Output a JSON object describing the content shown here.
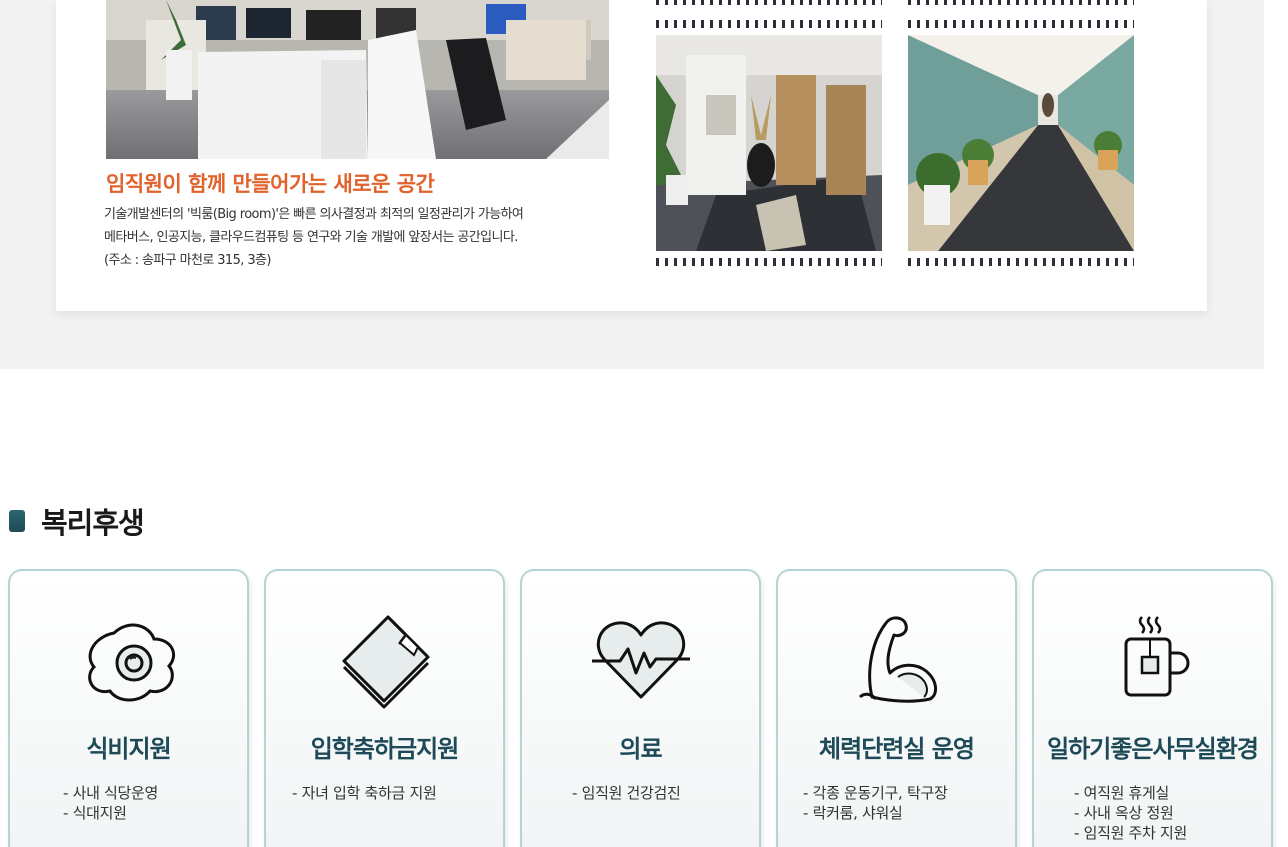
{
  "space": {
    "title": "임직원이 함께 만들어가는 새로운 공간",
    "desc_lines": [
      "기술개발센터의 '빅룸(Big room)'은 빠른 의사결정과 최적의 일정관리가 가능하여",
      "메타버스, 인공지능, 클라우드컴퓨팅 등 연구와 기술 개발에 앞장서는 공간입니다.",
      "(주소 : 송파구 마천로  315, 3층)"
    ]
  },
  "benefits_section": {
    "heading": "복리후생",
    "accent_color": "#1d4a55",
    "title_color": "#1e4a58",
    "cards": [
      {
        "icon": "fried-egg-icon",
        "title": "식비지원",
        "items": [
          "- 사내 식당운영",
          "- 식대지원"
        ]
      },
      {
        "icon": "book-icon",
        "title": "입학축하금지원",
        "items": [
          "- 자녀 입학 축하금 지원"
        ]
      },
      {
        "icon": "heartbeat-icon",
        "title": "의료",
        "items": [
          "- 임직원 건강검진"
        ]
      },
      {
        "icon": "flexed-arm-icon",
        "title": "체력단련실 운영",
        "items": [
          "- 각종 운동기구, 탁구장",
          "- 락커룸, 샤워실"
        ]
      },
      {
        "icon": "tea-cup-icon",
        "title": "일하기좋은사무실환경",
        "items": [
          "- 여직원 휴게실",
          "- 사내 옥상 정원",
          "- 임직원 주차 지원"
        ]
      }
    ]
  }
}
